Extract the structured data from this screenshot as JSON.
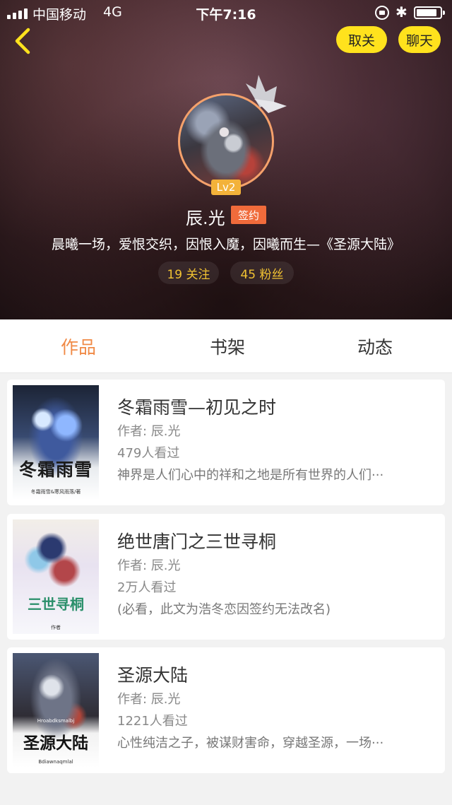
{
  "status_bar": {
    "carrier": "中国移动",
    "network": "4G",
    "time": "下午7:16",
    "bluetooth_icon": "bluetooth-icon",
    "battery_icon": "battery-icon"
  },
  "nav": {
    "unfollow_label": "取关",
    "chat_label": "聊天",
    "back_icon": "chevron-left-icon"
  },
  "profile": {
    "level": "Lv2",
    "name": "辰.光",
    "badge": "签约",
    "bio": "晨曦一场，爱恨交织，因恨入魔，因曦而生—《圣源大陆》",
    "following": "19 关注",
    "fans": "45 粉丝"
  },
  "tabs": [
    {
      "label": "作品",
      "active": true
    },
    {
      "label": "书架",
      "active": false
    },
    {
      "label": "动态",
      "active": false
    }
  ],
  "books": [
    {
      "title": "冬霜雨雪—初见之时",
      "author": "作者: 辰.光",
      "views": "479人看过",
      "desc": "神界是人们心中的祥和之地是所有世界的人们···",
      "cover_title": "冬霜雨雪",
      "cover_sub": "冬霜雨雪&寒风雨落/著"
    },
    {
      "title": "绝世唐门之三世寻桐",
      "author": "作者: 辰.光",
      "views": "2万人看过",
      "desc": "(必看，此文为浩冬恋因签约无法改名)",
      "cover_title": "三世寻桐",
      "cover_sub": "作者"
    },
    {
      "title": "圣源大陆",
      "author": "作者: 辰.光",
      "views": "1221人看过",
      "desc": "心性纯洁之子，被谋财害命，穿越圣源，一场···",
      "cover_title": "圣源大陆",
      "cover_sub": "Hroabdksmalbj",
      "cover_sub2": "Bdiawnaqmlal"
    }
  ],
  "colors": {
    "accent": "#f08a46",
    "pill": "#ffe21d",
    "badge": "#f06b3b",
    "stat_text": "#f1c232"
  }
}
